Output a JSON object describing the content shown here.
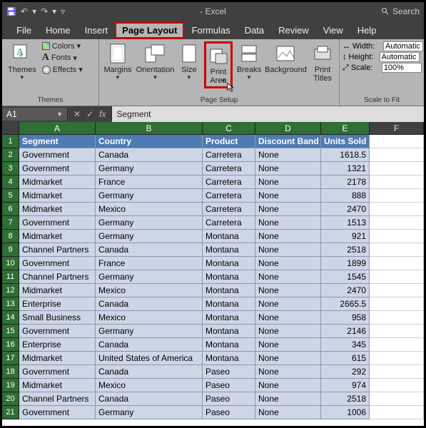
{
  "titlebar": {
    "title": "- Excel",
    "search_placeholder": "Search"
  },
  "tabs": [
    "File",
    "Home",
    "Insert",
    "Page Layout",
    "Formulas",
    "Data",
    "Review",
    "View",
    "Help"
  ],
  "active_tab_index": 3,
  "ribbon": {
    "themes": {
      "button": "Themes",
      "colors": "Colors",
      "fonts": "Fonts",
      "effects": "Effects",
      "group_label": "Themes"
    },
    "page_setup": {
      "margins": "Margins",
      "orientation": "Orientation",
      "size": "Size",
      "print_area": "Print\nArea",
      "breaks": "Breaks",
      "background": "Background",
      "print_titles": "Print\nTitles",
      "group_label": "Page Setup"
    },
    "scale": {
      "width_label": "Width:",
      "width_value": "Automatic",
      "height_label": "Height:",
      "height_value": "Automatic",
      "scale_label": "Scale:",
      "scale_value": "100%",
      "group_label": "Scale to Fit"
    }
  },
  "namebox": "A1",
  "formula_value": "Segment",
  "columns": [
    "A",
    "B",
    "C",
    "D",
    "E",
    "F"
  ],
  "header_row": [
    "Segment",
    "Country",
    "Product",
    "Discount Band",
    "Units Sold"
  ],
  "rows": [
    [
      "Government",
      "Canada",
      "Carretera",
      "None",
      "1618.5"
    ],
    [
      "Government",
      "Germany",
      "Carretera",
      "None",
      "1321"
    ],
    [
      "Midmarket",
      "France",
      "Carretera",
      "None",
      "2178"
    ],
    [
      "Midmarket",
      "Germany",
      "Carretera",
      "None",
      "888"
    ],
    [
      "Midmarket",
      "Mexico",
      "Carretera",
      "None",
      "2470"
    ],
    [
      "Government",
      "Germany",
      "Carretera",
      "None",
      "1513"
    ],
    [
      "Midmarket",
      "Germany",
      "Montana",
      "None",
      "921"
    ],
    [
      "Channel Partners",
      "Canada",
      "Montana",
      "None",
      "2518"
    ],
    [
      "Government",
      "France",
      "Montana",
      "None",
      "1899"
    ],
    [
      "Channel Partners",
      "Germany",
      "Montana",
      "None",
      "1545"
    ],
    [
      "Midmarket",
      "Mexico",
      "Montana",
      "None",
      "2470"
    ],
    [
      "Enterprise",
      "Canada",
      "Montana",
      "None",
      "2665.5"
    ],
    [
      "Small Business",
      "Mexico",
      "Montana",
      "None",
      "958"
    ],
    [
      "Government",
      "Germany",
      "Montana",
      "None",
      "2146"
    ],
    [
      "Enterprise",
      "Canada",
      "Montana",
      "None",
      "345"
    ],
    [
      "Midmarket",
      "United States of America",
      "Montana",
      "None",
      "615"
    ],
    [
      "Government",
      "Canada",
      "Paseo",
      "None",
      "292"
    ],
    [
      "Midmarket",
      "Mexico",
      "Paseo",
      "None",
      "974"
    ],
    [
      "Channel Partners",
      "Canada",
      "Paseo",
      "None",
      "2518"
    ],
    [
      "Government",
      "Germany",
      "Paseo",
      "None",
      "1006"
    ]
  ]
}
